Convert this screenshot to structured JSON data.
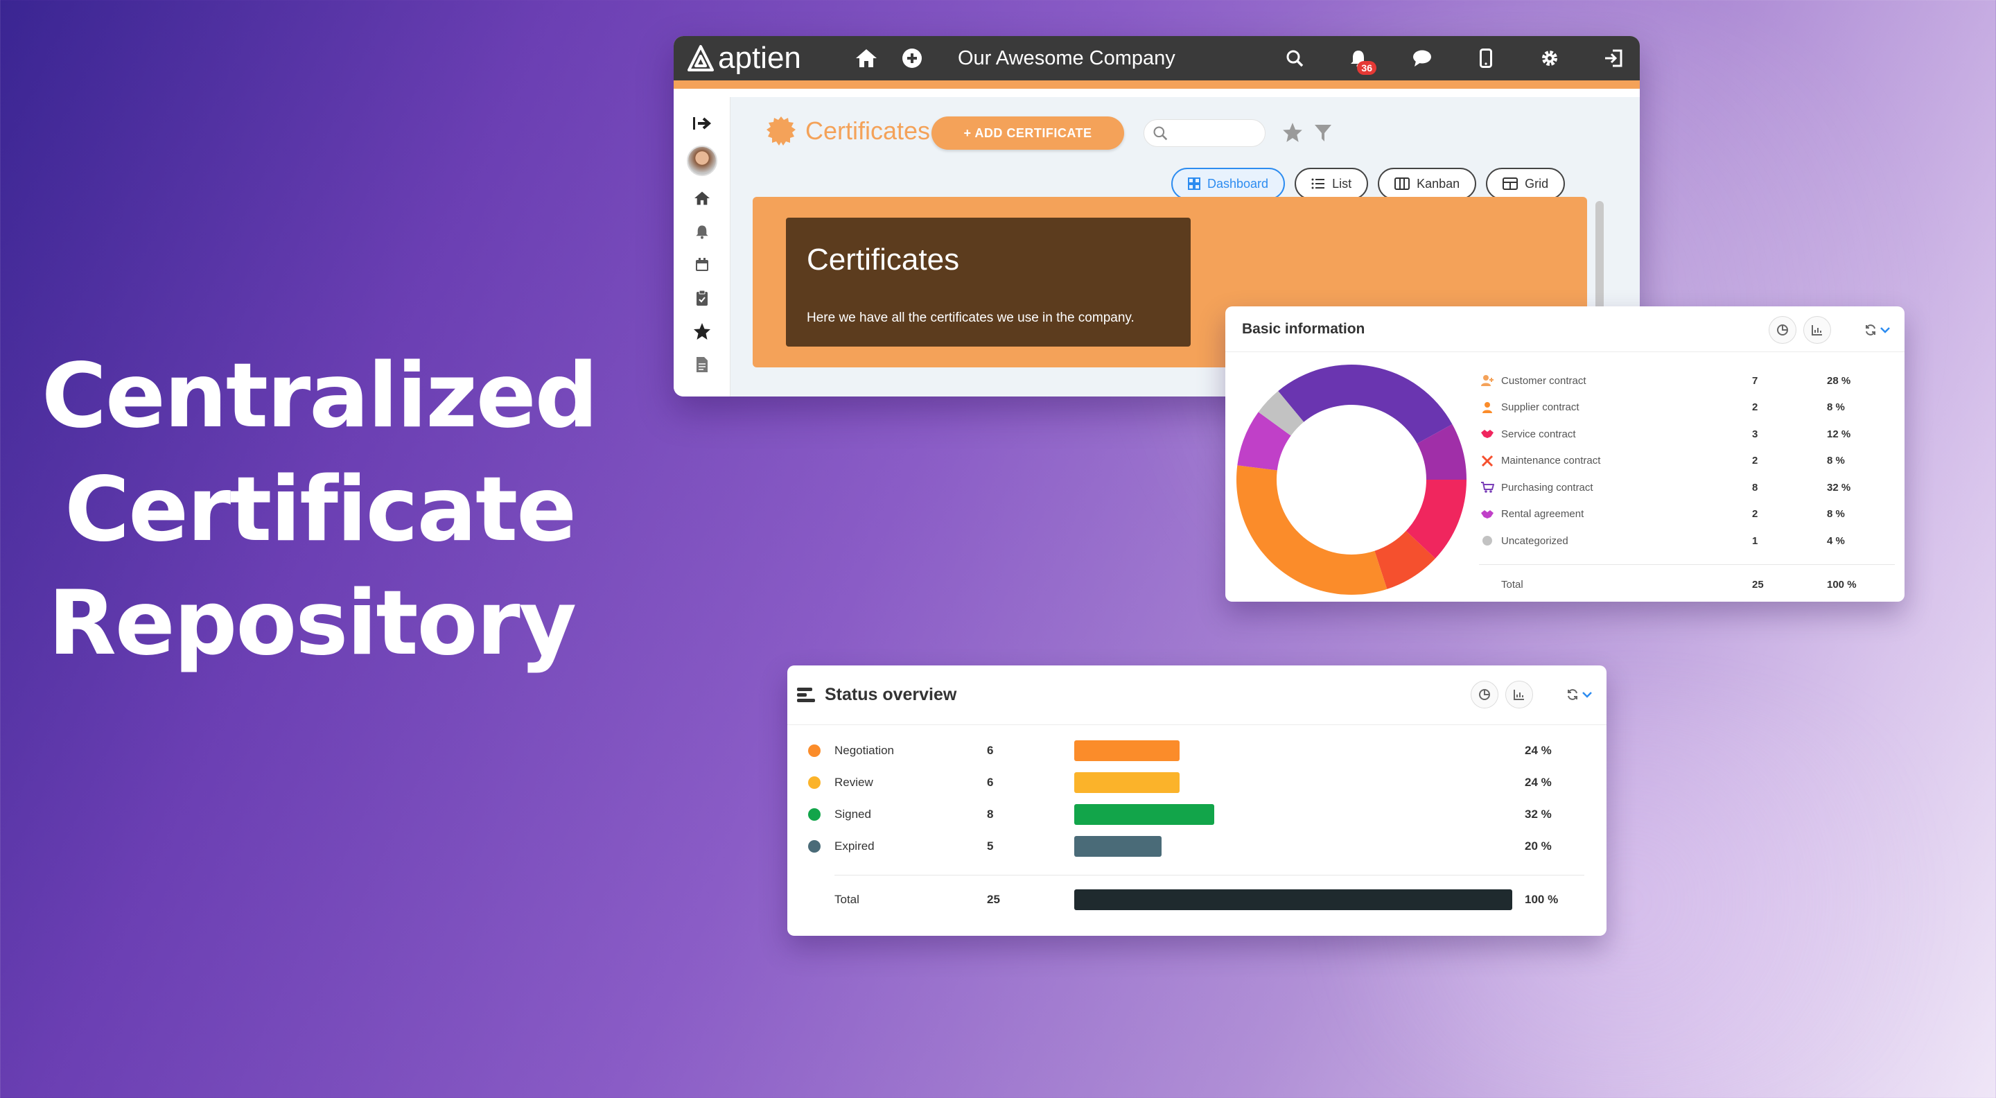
{
  "hero": {
    "lines": [
      "Centralized",
      "Certificate",
      "Repository"
    ]
  },
  "app": {
    "logo_text": "aptien",
    "company": "Our Awesome Company",
    "notifications_count": "36",
    "toolbar_icons": [
      "home-icon",
      "plus-circle-icon",
      "search-icon",
      "bell-icon",
      "chat-icon",
      "mobile-icon",
      "gear-icon",
      "logout-icon"
    ],
    "sidebar_icons": [
      "expand-icon",
      "avatar",
      "home-icon",
      "bell-icon",
      "calendar-icon",
      "clipboard-icon",
      "star-icon",
      "document-icon"
    ],
    "module_title": "Certificates",
    "add_button": "+ ADD CERTIFICATE",
    "search_placeholder": "",
    "views": [
      {
        "label": "Dashboard",
        "active": true
      },
      {
        "label": "List",
        "active": false
      },
      {
        "label": "Kanban",
        "active": false
      },
      {
        "label": "Grid",
        "active": false
      }
    ],
    "banner": {
      "title": "Certificates",
      "text": "Here we have all the certificates we use in the company."
    },
    "colors": {
      "accent": "#f4a259",
      "topbar": "#3a3a3a",
      "banner_card": "#5c3c1e",
      "primary": "#2d8cf0"
    }
  },
  "basic_info": {
    "title": "Basic information",
    "rows": [
      {
        "label": "Customer contract",
        "value": "7",
        "pct": "28 %",
        "color": "#6a35b0"
      },
      {
        "label": "Supplier contract",
        "value": "2",
        "pct": "8 %",
        "color": "#a02fa8"
      },
      {
        "label": "Service contract",
        "value": "3",
        "pct": "12 %",
        "color": "#f0265e"
      },
      {
        "label": "Maintenance contract",
        "value": "2",
        "pct": "8 %",
        "color": "#f5502e"
      },
      {
        "label": "Purchasing contract",
        "value": "8",
        "pct": "32 %",
        "color": "#fb8c2a"
      },
      {
        "label": "Rental agreement",
        "value": "2",
        "pct": "8 %",
        "color": "#c040c8"
      },
      {
        "label": "Uncategorized",
        "value": "1",
        "pct": "4 %",
        "color": "#c2c2c2"
      }
    ],
    "total": {
      "label": "Total",
      "value": "25",
      "pct": "100 %"
    }
  },
  "status_overview": {
    "title": "Status overview",
    "rows": [
      {
        "label": "Negotiation",
        "value": "6",
        "pct": "24 %",
        "fraction": 0.24,
        "color": "#fb8c2a"
      },
      {
        "label": "Review",
        "value": "6",
        "pct": "24 %",
        "fraction": 0.24,
        "color": "#fbb32a"
      },
      {
        "label": "Signed",
        "value": "8",
        "pct": "32 %",
        "fraction": 0.32,
        "color": "#12a54a"
      },
      {
        "label": "Expired",
        "value": "5",
        "pct": "20 %",
        "fraction": 0.2,
        "color": "#4a6b78"
      }
    ],
    "total": {
      "label": "Total",
      "value": "25",
      "pct": "100 %",
      "fraction": 1.0,
      "color": "#1f2a2e"
    }
  },
  "chart_data": [
    {
      "type": "pie",
      "title": "Basic information",
      "categories": [
        "Customer contract",
        "Supplier contract",
        "Service contract",
        "Maintenance contract",
        "Purchasing contract",
        "Rental agreement",
        "Uncategorized"
      ],
      "values": [
        7,
        2,
        3,
        2,
        8,
        2,
        1
      ]
    },
    {
      "type": "bar",
      "title": "Status overview",
      "categories": [
        "Negotiation",
        "Review",
        "Signed",
        "Expired"
      ],
      "values": [
        6,
        6,
        8,
        5
      ]
    }
  ]
}
